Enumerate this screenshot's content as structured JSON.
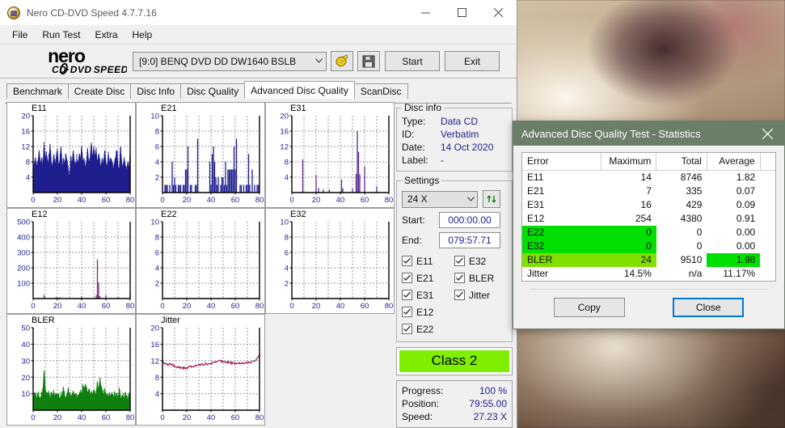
{
  "window": {
    "title": "Nero CD-DVD Speed 4.7.7.16",
    "icon": "nero-disc-icon",
    "minimize_label": "–",
    "maximize_label": "□",
    "close_label": "✕"
  },
  "menubar": {
    "items": [
      "File",
      "Run Test",
      "Extra",
      "Help"
    ]
  },
  "toolbar": {
    "logo_line1": "nero",
    "logo_line2": "CD·DVD SPEED",
    "drive": "[9:0]   BENQ DVD DD DW1640 BSLB",
    "drive_chevron": "∨",
    "eject_icon": "eject-disc-icon",
    "save_icon": "floppy-save-icon",
    "start_label": "Start",
    "exit_label": "Exit"
  },
  "tabs": {
    "items": [
      "Benchmark",
      "Create Disc",
      "Disc Info",
      "Disc Quality",
      "Advanced Disc Quality",
      "ScanDisc"
    ],
    "active": "Advanced Disc Quality"
  },
  "disc_info": {
    "legend": "Disc info",
    "rows": [
      {
        "key": "Type:",
        "value": "Data CD"
      },
      {
        "key": "ID:",
        "value": "Verbatim"
      },
      {
        "key": "Date:",
        "value": "14 Oct 2020"
      },
      {
        "key": "Label:",
        "value": "-"
      }
    ]
  },
  "settings": {
    "legend": "Settings",
    "speed": "24 X",
    "speed_chevron": "∨",
    "refresh_icon": "refresh-arrows-icon",
    "start_label": "Start:",
    "start_value": "000:00.00",
    "end_label": "End:",
    "end_value": "079:57.71",
    "checkboxes": [
      {
        "label": "E11",
        "checked": true
      },
      {
        "label": "E32",
        "checked": true
      },
      {
        "label": "E21",
        "checked": true
      },
      {
        "label": "BLER",
        "checked": true
      },
      {
        "label": "E31",
        "checked": true
      },
      {
        "label": "Jitter",
        "checked": true
      },
      {
        "label": "E12",
        "checked": true
      },
      {
        "label": "",
        "checked": false
      },
      {
        "label": "E22",
        "checked": true
      },
      {
        "label": "",
        "checked": false
      }
    ]
  },
  "class_badge": {
    "label": "Class 2",
    "color": "#80ee00"
  },
  "progress": {
    "rows": [
      {
        "key": "Progress:",
        "value": "100 %"
      },
      {
        "key": "Position:",
        "value": "79:55.00"
      },
      {
        "key": "Speed:",
        "value": "27.23 X"
      }
    ]
  },
  "stats_dialog": {
    "title": "Advanced Disc Quality Test - Statistics",
    "close_icon": "close-icon",
    "headers": [
      "Error",
      "Maximum",
      "Total",
      "Average",
      ""
    ],
    "rows": [
      {
        "error": "E11",
        "maximum": "14",
        "total": "8746",
        "average": "1.82",
        "highlight": "none"
      },
      {
        "error": "E21",
        "maximum": "7",
        "total": "335",
        "average": "0.07",
        "highlight": "none"
      },
      {
        "error": "E31",
        "maximum": "16",
        "total": "429",
        "average": "0.09",
        "highlight": "none"
      },
      {
        "error": "E12",
        "maximum": "254",
        "total": "4380",
        "average": "0.91",
        "highlight": "none"
      },
      {
        "error": "E22",
        "maximum": "0",
        "total": "0",
        "average": "0.00",
        "highlight": "green"
      },
      {
        "error": "E32",
        "maximum": "0",
        "total": "0",
        "average": "0.00",
        "highlight": "green"
      },
      {
        "error": "BLER",
        "maximum": "24",
        "total": "9510",
        "average": "1.98",
        "highlight": "yellowgreen",
        "average_highlight": "green"
      },
      {
        "error": "Jitter",
        "maximum": "14.5%",
        "total": "n/a",
        "average": "11.17%",
        "highlight": "none"
      }
    ],
    "copy_label": "Copy",
    "close_label": "Close",
    "colors": {
      "title_bar": "#6b7f68",
      "green": "#00e000",
      "yellow_green": "#80e000",
      "focus": "#0078d7"
    }
  },
  "chart_data": [
    {
      "type": "area",
      "title": "E11",
      "xlabel": "",
      "ylabel": "",
      "xlim": [
        0,
        80
      ],
      "ylim": [
        0,
        20
      ],
      "xticks": [
        0,
        20,
        40,
        60,
        80
      ],
      "yticks": [
        4,
        8,
        12,
        16,
        20
      ],
      "grid": true,
      "color": "#1f1f8f",
      "baseline_fill": true,
      "x": [
        0,
        1,
        2,
        3,
        4,
        5,
        6,
        7,
        8,
        9,
        10,
        11,
        12,
        13,
        14,
        15,
        16,
        17,
        18,
        19,
        20,
        21,
        22,
        23,
        24,
        25,
        26,
        27,
        28,
        29,
        30,
        31,
        32,
        33,
        34,
        35,
        36,
        37,
        38,
        39,
        40,
        41,
        42,
        43,
        44,
        45,
        46,
        47,
        48,
        49,
        50,
        51,
        52,
        53,
        54,
        55,
        56,
        57,
        58,
        59,
        60,
        61,
        62,
        63,
        64,
        65,
        66,
        67,
        68,
        69,
        70,
        71,
        72,
        73,
        74,
        75,
        76,
        77,
        78,
        79,
        80
      ],
      "values": [
        5,
        7,
        9,
        6,
        8,
        11,
        7,
        9,
        6,
        13,
        8,
        10,
        7,
        9,
        12,
        8,
        6,
        10,
        7,
        9,
        11,
        7,
        8,
        12,
        6,
        9,
        7,
        10,
        8,
        6,
        3,
        9,
        7,
        11,
        8,
        6,
        9,
        7,
        10,
        8,
        12,
        7,
        9,
        6,
        8,
        11,
        7,
        9,
        13,
        8,
        12,
        9,
        11,
        7,
        10,
        8,
        6,
        9,
        7,
        11,
        8,
        6,
        10,
        7,
        9,
        8,
        6,
        7,
        9,
        11,
        7,
        5,
        12,
        8,
        6,
        9,
        7,
        5,
        8,
        6,
        10
      ]
    },
    {
      "type": "bar",
      "title": "E21",
      "xlabel": "",
      "ylabel": "",
      "xlim": [
        0,
        80
      ],
      "ylim": [
        0,
        10
      ],
      "xticks": [
        0,
        20,
        40,
        60,
        80
      ],
      "yticks": [
        2,
        4,
        6,
        8,
        10
      ],
      "grid": true,
      "color": "#1f1f8f",
      "x": [
        0,
        1,
        2,
        3,
        4,
        5,
        6,
        7,
        8,
        9,
        10,
        11,
        12,
        13,
        14,
        15,
        16,
        17,
        18,
        19,
        20,
        21,
        22,
        23,
        24,
        25,
        26,
        27,
        28,
        29,
        30,
        31,
        32,
        33,
        34,
        35,
        36,
        37,
        38,
        39,
        40,
        41,
        42,
        43,
        44,
        45,
        46,
        47,
        48,
        49,
        50,
        51,
        52,
        53,
        54,
        55,
        56,
        57,
        58,
        59,
        60,
        61,
        62,
        63,
        64,
        65,
        66,
        67,
        68,
        69,
        70,
        71,
        72,
        73,
        74,
        75,
        76,
        77,
        78,
        79,
        80
      ],
      "values": [
        0,
        0,
        1,
        1,
        1,
        0,
        1,
        0,
        4,
        1,
        2,
        1,
        0,
        1,
        1,
        1,
        0,
        1,
        1,
        3,
        3,
        6,
        0,
        1,
        1,
        0,
        0,
        1,
        1,
        7,
        0,
        0,
        0,
        0,
        0,
        0,
        0,
        0,
        0,
        4,
        1,
        5,
        6,
        4,
        2,
        1,
        2,
        0,
        1,
        2,
        2,
        1,
        4,
        1,
        3,
        3,
        3,
        3,
        3,
        6,
        3,
        7,
        0,
        0,
        1,
        1,
        0,
        1,
        0,
        1,
        1,
        5,
        1,
        0,
        3,
        0,
        1,
        0,
        1,
        1,
        0
      ]
    },
    {
      "type": "bar",
      "title": "E31",
      "xlabel": "",
      "ylabel": "",
      "xlim": [
        0,
        80
      ],
      "ylim": [
        0,
        20
      ],
      "xticks": [
        0,
        20,
        40,
        60,
        80
      ],
      "yticks": [
        4,
        8,
        12,
        16,
        20
      ],
      "grid": true,
      "color": "#5a2a8f",
      "x": [
        9,
        20,
        22,
        26,
        31,
        41,
        42,
        50,
        53,
        54,
        55,
        56,
        60,
        70,
        80
      ],
      "values": [
        8.6,
        4.5,
        1.2,
        0.8,
        0.8,
        3.4,
        1.1,
        1.0,
        4.9,
        16,
        10.6,
        4.8,
        6.8,
        1.6,
        7.2
      ]
    },
    {
      "type": "bar",
      "title": "E12",
      "xlabel": "",
      "ylabel": "",
      "xlim": [
        0,
        80
      ],
      "ylim": [
        0,
        500
      ],
      "xticks": [
        0,
        20,
        40,
        60,
        80
      ],
      "yticks": [
        100,
        200,
        300,
        400,
        500
      ],
      "grid": true,
      "color": "#7a2a7a",
      "x": [
        9,
        19,
        22,
        40,
        52,
        53,
        54,
        55,
        60,
        70,
        80
      ],
      "values": [
        24,
        10,
        8,
        14,
        22,
        254,
        104,
        16,
        22,
        10,
        26
      ]
    },
    {
      "type": "bar",
      "title": "E22",
      "xlabel": "",
      "ylabel": "",
      "xlim": [
        0,
        80
      ],
      "ylim": [
        0,
        10
      ],
      "xticks": [
        0,
        20,
        40,
        60,
        80
      ],
      "yticks": [
        2,
        4,
        6,
        8,
        10
      ],
      "grid": true,
      "color": "#1f1f8f",
      "x": [],
      "values": []
    },
    {
      "type": "bar",
      "title": "E32",
      "xlabel": "",
      "ylabel": "",
      "xlim": [
        0,
        80
      ],
      "ylim": [
        0,
        10
      ],
      "xticks": [
        0,
        20,
        40,
        60,
        80
      ],
      "yticks": [
        2,
        4,
        6,
        8,
        10
      ],
      "grid": true,
      "color": "#1f1f8f",
      "x": [],
      "values": []
    },
    {
      "type": "area",
      "title": "BLER",
      "xlabel": "",
      "ylabel": "",
      "xlim": [
        0,
        80
      ],
      "ylim": [
        0,
        50
      ],
      "xticks": [
        0,
        20,
        40,
        60,
        80
      ],
      "yticks": [
        10,
        20,
        30,
        40,
        50
      ],
      "grid": true,
      "color": "#108010",
      "baseline_fill": true,
      "x": [
        0,
        1,
        2,
        3,
        4,
        5,
        6,
        7,
        8,
        9,
        10,
        11,
        12,
        13,
        14,
        15,
        16,
        17,
        18,
        19,
        20,
        21,
        22,
        23,
        24,
        25,
        26,
        27,
        28,
        29,
        30,
        31,
        32,
        33,
        34,
        35,
        36,
        37,
        38,
        39,
        40,
        41,
        42,
        43,
        44,
        45,
        46,
        47,
        48,
        49,
        50,
        51,
        52,
        53,
        54,
        55,
        56,
        57,
        58,
        59,
        60,
        61,
        62,
        63,
        64,
        65,
        66,
        67,
        68,
        69,
        70,
        71,
        72,
        73,
        74,
        75,
        76,
        77,
        78,
        79,
        80
      ],
      "values": [
        6,
        8,
        9,
        7,
        10,
        8,
        7,
        9,
        11,
        24,
        13,
        9,
        8,
        10,
        7,
        9,
        8,
        11,
        7,
        9,
        10,
        8,
        7,
        9,
        8,
        13,
        9,
        7,
        10,
        12,
        8,
        9,
        7,
        11,
        8,
        10,
        7,
        9,
        8,
        12,
        9,
        14,
        11,
        16,
        12,
        10,
        13,
        9,
        11,
        8,
        12,
        10,
        9,
        17,
        11,
        19,
        13,
        10,
        9,
        12,
        8,
        10,
        7,
        9,
        8,
        11,
        7,
        9,
        8,
        10,
        7,
        12,
        8,
        6,
        9,
        7,
        10,
        8,
        6,
        9,
        8
      ]
    },
    {
      "type": "line",
      "title": "Jitter",
      "xlabel": "",
      "ylabel": "",
      "xlim": [
        0,
        80
      ],
      "ylim": [
        0,
        20
      ],
      "xticks": [
        0,
        20,
        40,
        60,
        80
      ],
      "yticks": [
        4,
        8,
        12,
        16,
        20
      ],
      "grid": true,
      "color": "#a01050",
      "x": [
        0,
        1,
        2,
        3,
        4,
        5,
        6,
        7,
        8,
        9,
        10,
        11,
        12,
        13,
        14,
        15,
        16,
        17,
        18,
        19,
        20,
        21,
        22,
        23,
        24,
        25,
        26,
        27,
        28,
        29,
        30,
        31,
        32,
        33,
        34,
        35,
        36,
        37,
        38,
        39,
        40,
        41,
        42,
        43,
        44,
        45,
        46,
        47,
        48,
        49,
        50,
        51,
        52,
        53,
        54,
        55,
        56,
        57,
        58,
        59,
        60,
        61,
        62,
        63,
        64,
        65,
        66,
        67,
        68,
        69,
        70,
        71,
        72,
        73,
        74,
        75,
        76,
        77,
        78,
        79,
        80
      ],
      "values": [
        11.9,
        11.5,
        11.2,
        11.3,
        11.1,
        11.0,
        11.2,
        10.9,
        11.1,
        10.8,
        10.6,
        10.7,
        10.5,
        10.6,
        10.4,
        10.3,
        10.4,
        10.2,
        10.3,
        10.2,
        10.1,
        10.3,
        10.5,
        10.6,
        10.5,
        10.7,
        10.6,
        10.8,
        10.9,
        10.8,
        11.0,
        11.1,
        11.0,
        11.2,
        11.1,
        11.3,
        11.2,
        11.1,
        11.3,
        11.2,
        11.4,
        11.3,
        11.5,
        11.6,
        11.7,
        11.9,
        11.8,
        12.0,
        11.9,
        11.8,
        11.7,
        11.6,
        11.7,
        11.6,
        11.5,
        11.6,
        11.5,
        11.4,
        11.5,
        11.4,
        11.3,
        11.4,
        11.3,
        11.4,
        11.3,
        11.2,
        11.3,
        11.4,
        11.3,
        11.5,
        11.4,
        11.6,
        11.5,
        11.7,
        11.8,
        12.0,
        11.9,
        12.2,
        12.5,
        12.9,
        13.5
      ]
    }
  ]
}
